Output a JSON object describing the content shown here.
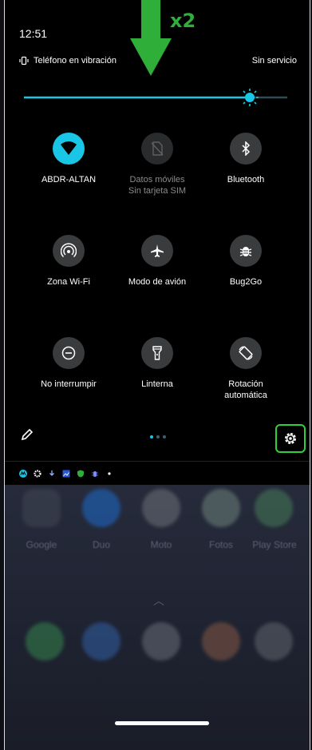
{
  "status": {
    "time": "12:51",
    "ringer_mode": "Teléfono en vibración",
    "carrier": "Sin servicio"
  },
  "brightness_level": 0.9,
  "tiles": [
    {
      "label": "ABDR-ALTAN",
      "sublabel": "",
      "icon": "wifi-icon",
      "active": true
    },
    {
      "label": "Datos móviles",
      "sublabel": "Sin tarjeta SIM",
      "icon": "no-sim-icon",
      "active": false,
      "disabled": true
    },
    {
      "label": "Bluetooth",
      "sublabel": "",
      "icon": "bluetooth-icon",
      "active": false
    },
    {
      "label": "Zona Wi-Fi",
      "sublabel": "",
      "icon": "hotspot-icon",
      "active": false
    },
    {
      "label": "Modo de avión",
      "sublabel": "",
      "icon": "airplane-icon",
      "active": false
    },
    {
      "label": "Bug2Go",
      "sublabel": "",
      "icon": "bug-icon",
      "active": false
    },
    {
      "label": "No interrumpir",
      "sublabel": "",
      "icon": "dnd-icon",
      "active": false
    },
    {
      "label": "Linterna",
      "sublabel": "",
      "icon": "flashlight-icon",
      "active": false
    },
    {
      "label": "Rotación",
      "sublabel": "automática",
      "icon": "rotation-icon",
      "active": false
    }
  ],
  "page_indicator": {
    "pages": 3,
    "current": 1
  },
  "annotation": {
    "text": "x2",
    "color": "#2fae3a"
  },
  "home_apps_row1": [
    "Google",
    "Duo",
    "Moto",
    "Fotos",
    "Play Store"
  ],
  "colors": {
    "accent": "#19c6e5",
    "highlight": "#2fd13a"
  }
}
